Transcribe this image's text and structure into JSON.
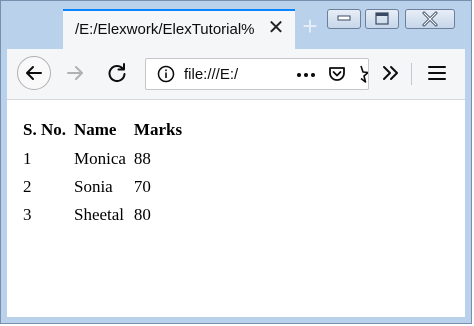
{
  "browser": {
    "tab_title": "/E:/Elexwork/ElexTutorial%",
    "url": "file:///E:/",
    "icons": [
      "back-icon",
      "forward-icon",
      "reload-icon",
      "info-icon",
      "more-icon",
      "pocket-icon",
      "bookmark-star-icon",
      "overflow-icon",
      "menu-icon",
      "tab-close-icon",
      "new-tab-icon",
      "minimize-icon",
      "maximize-icon",
      "window-close-icon"
    ],
    "accent": "#0a84ff"
  },
  "table": {
    "headers": [
      "S. No.",
      "Name",
      "Marks"
    ],
    "rows": [
      [
        "1",
        "Monica",
        "88"
      ],
      [
        "2",
        "Sonia",
        "70"
      ],
      [
        "3",
        "Sheetal",
        "80"
      ]
    ]
  }
}
